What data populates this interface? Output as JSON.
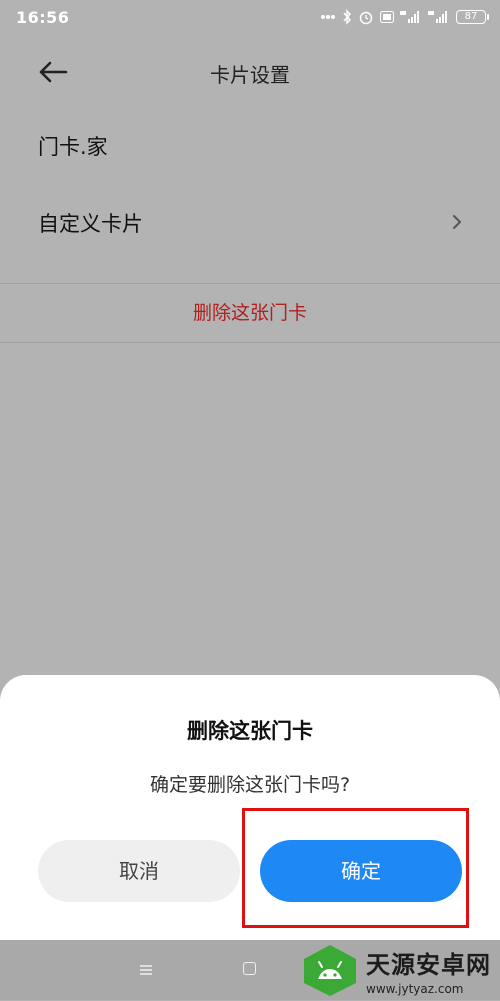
{
  "status_bar": {
    "time": "16:56",
    "battery": "87"
  },
  "header": {
    "title": "卡片设置"
  },
  "settings": {
    "card_name": "门卡.家",
    "customize_label": "自定义卡片",
    "delete_label": "删除这张门卡"
  },
  "dialog": {
    "title": "删除这张门卡",
    "message": "确定要删除这张门卡吗?",
    "cancel_label": "取消",
    "confirm_label": "确定"
  },
  "watermark": {
    "name": "天源安卓网",
    "url": "www.jytyaz.com"
  },
  "colors": {
    "confirm_button": "#1e88f5",
    "delete_text": "#b02020",
    "highlight_box": "#e01010"
  }
}
